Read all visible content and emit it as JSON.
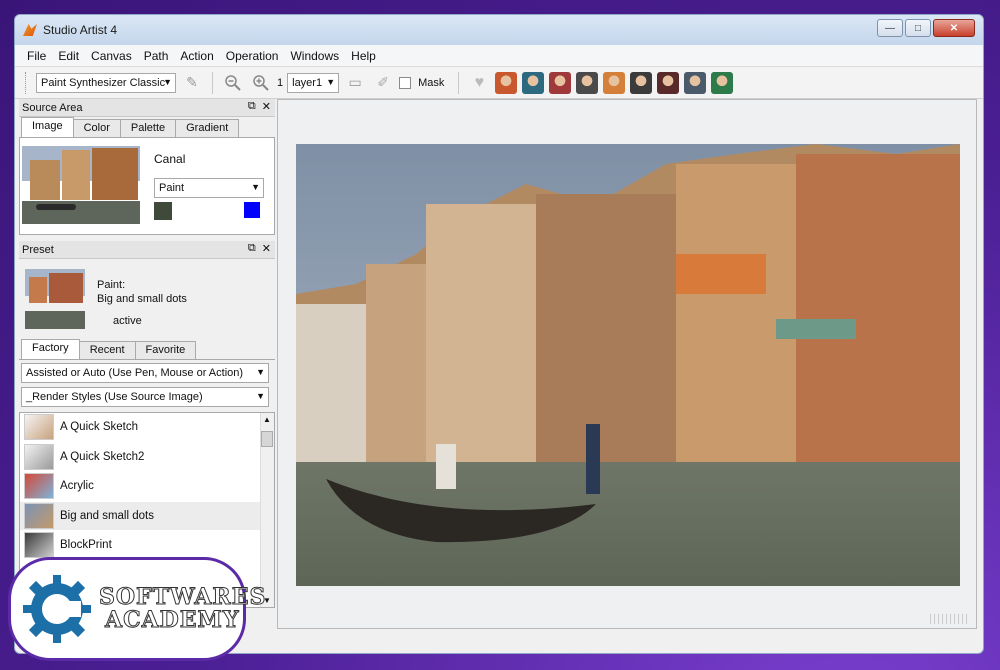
{
  "window": {
    "title": "Studio Artist 4"
  },
  "menu": [
    "File",
    "Edit",
    "Canvas",
    "Path",
    "Action",
    "Operation",
    "Windows",
    "Help"
  ],
  "toolbar": {
    "synth_select": "Paint Synthesizer Classic",
    "layer_number": "1",
    "layer_select": "layer1",
    "mask_label": "Mask",
    "avatar_colors": [
      "#c9582e",
      "#2d6a80",
      "#a03a3a",
      "#4a4a4a",
      "#d4803a",
      "#3b3b3b",
      "#5a2a2a",
      "#4a5a6a",
      "#2d7a4a"
    ]
  },
  "source_area": {
    "title": "Source Area",
    "tabs": [
      "Image",
      "Color",
      "Palette",
      "Gradient"
    ],
    "image_name": "Canal",
    "mode_select": "Paint",
    "swatch_colors": [
      "#3f4a3a",
      "#0000ff"
    ]
  },
  "preset": {
    "title": "Preset",
    "type": "Paint:",
    "name": "Big and small dots",
    "status": "active"
  },
  "library": {
    "tabs": [
      "Factory",
      "Recent",
      "Favorite"
    ],
    "category_select": "Assisted or Auto (Use Pen, Mouse or Action)",
    "style_select": "_Render Styles (Use Source Image)",
    "items": [
      {
        "label": "A Quick Sketch"
      },
      {
        "label": "A Quick Sketch2"
      },
      {
        "label": "Acrylic"
      },
      {
        "label": "Big and small dots"
      },
      {
        "label": "BlockPrint"
      }
    ]
  },
  "watermark": {
    "line1": "SOFTWARES",
    "line2": "ACADEMY"
  },
  "colors": {
    "accent": "#5b2aa7",
    "selection": "#ececec"
  }
}
